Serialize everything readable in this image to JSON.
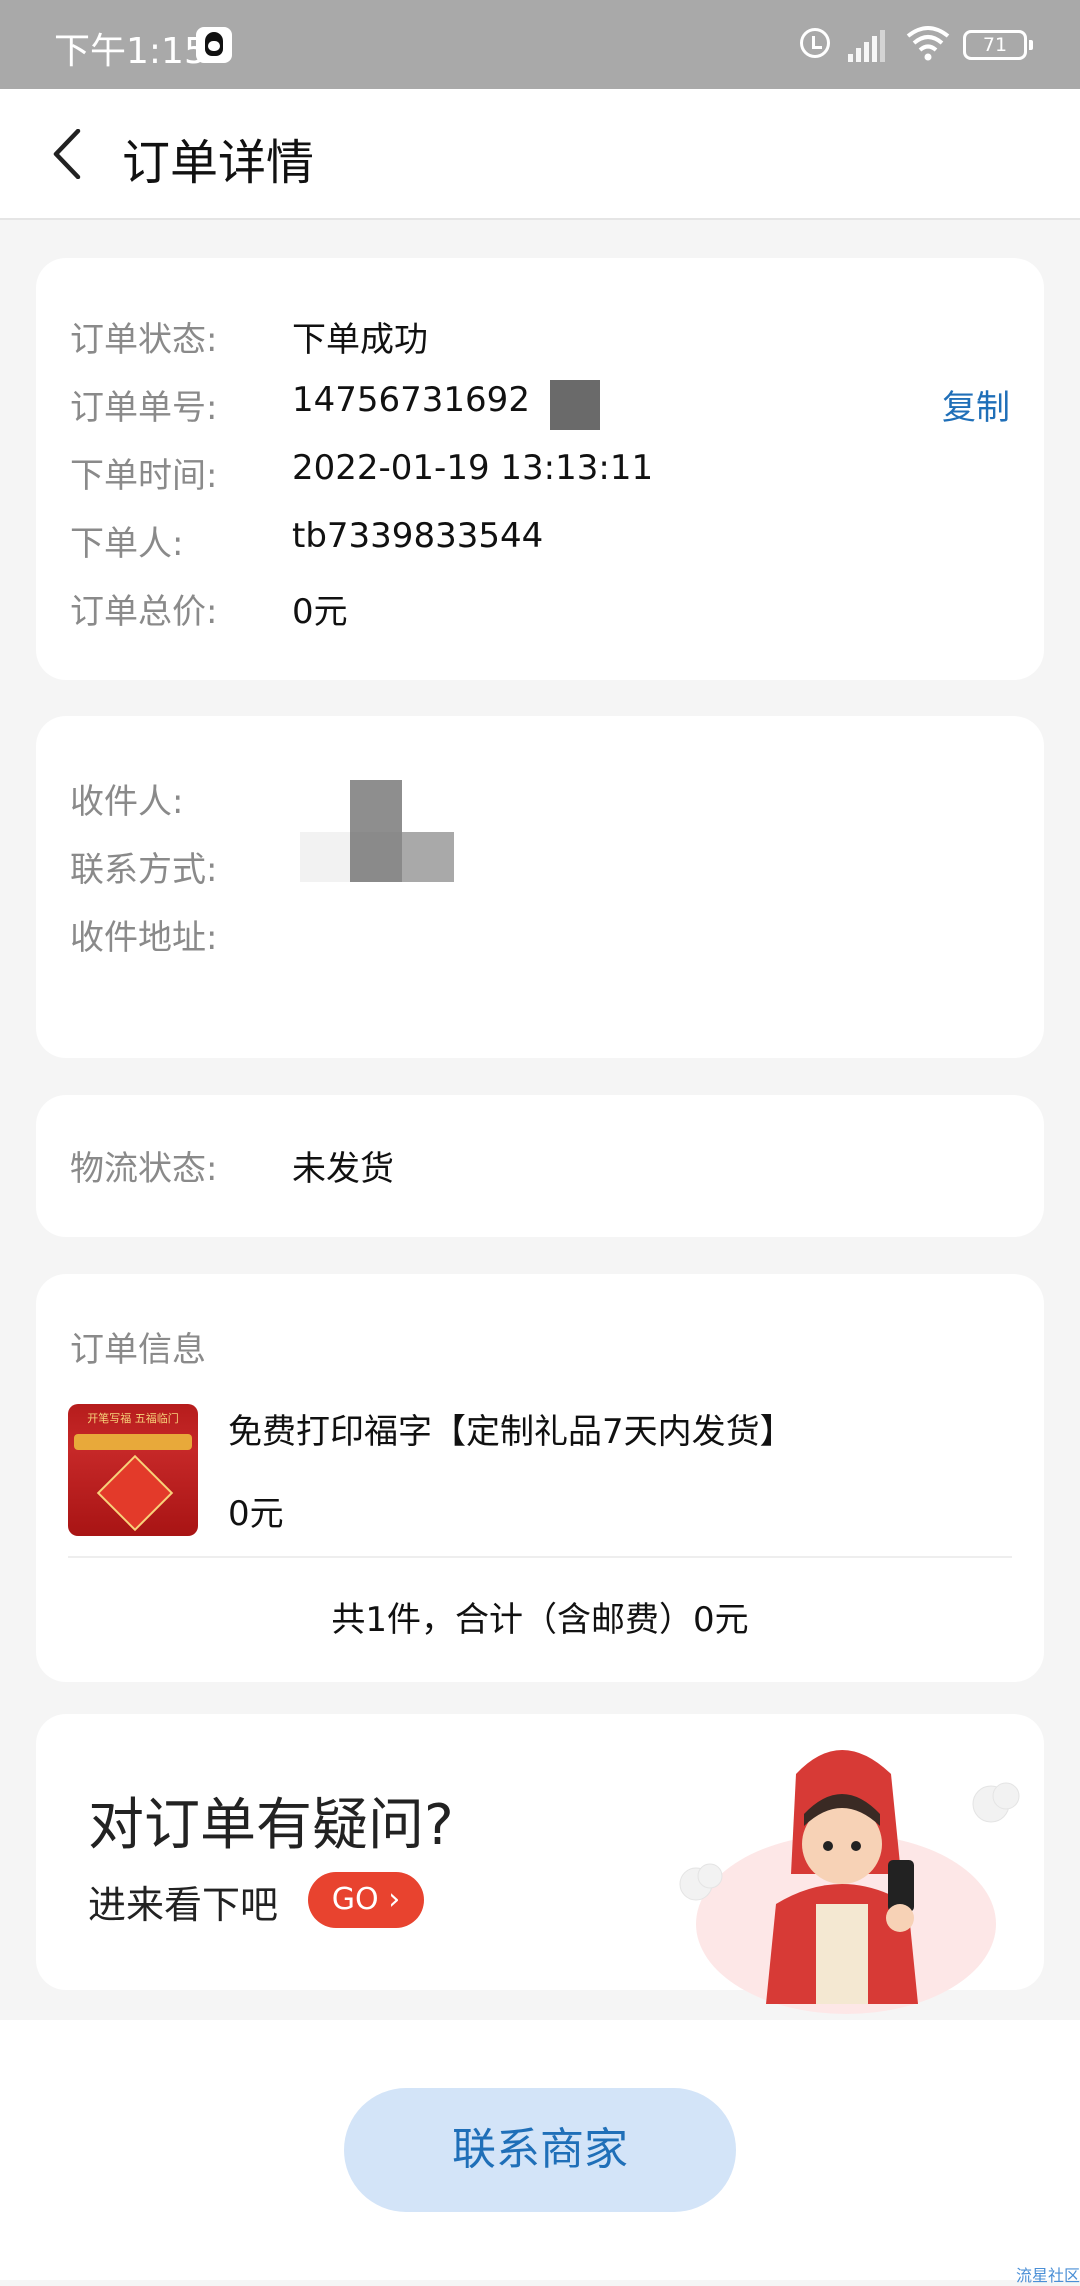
{
  "status_bar": {
    "time": "下午1:15",
    "battery": "71",
    "icons": [
      "qq-icon",
      "alarm-icon",
      "signal-icon",
      "wifi-icon",
      "battery-icon"
    ]
  },
  "header": {
    "title": "订单详情",
    "back_icon": "back-arrow-icon"
  },
  "order_summary": {
    "status_label": "订单状态:",
    "status_value": "下单成功",
    "number_label": "订单单号:",
    "number_value": "14756731692",
    "copy_label": "复制",
    "time_label": "下单时间:",
    "time_value": "2022-01-19 13:13:11",
    "buyer_label": "下单人:",
    "buyer_value": "tb7339833544",
    "total_label": "订单总价:",
    "total_value": "0元"
  },
  "recipient": {
    "name_label": "收件人:",
    "phone_label": "联系方式:",
    "address_label": "收件地址:"
  },
  "logistics": {
    "label": "物流状态:",
    "value": "未发货"
  },
  "order_info": {
    "title": "订单信息",
    "product_name": "免费打印福字【定制礼品7天内发货】",
    "product_price": "0元",
    "product_image_text": "开笔写福 五福临门",
    "summary": "共1件，合计（含邮费）0元"
  },
  "help_banner": {
    "title": "对订单有疑问?",
    "subtitle": "进来看下吧",
    "go_label": "GO"
  },
  "footer": {
    "contact_button": "联系商家",
    "watermark": "流星社区"
  },
  "colors": {
    "accent_blue": "#1f6fb8",
    "go_red": "#e8432f",
    "contact_bg": "#d3e4f8"
  }
}
